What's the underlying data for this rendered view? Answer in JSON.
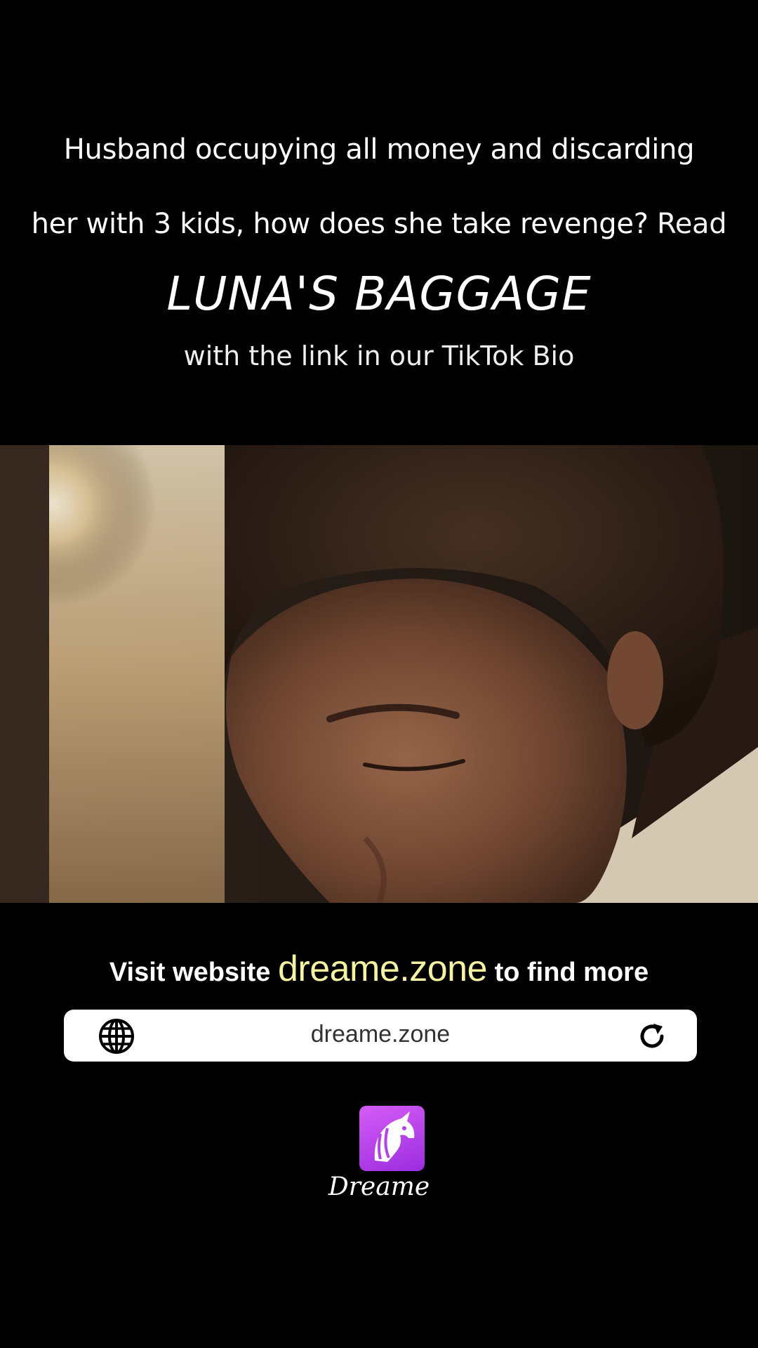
{
  "promo": {
    "line1": "Husband occupying all money and discarding",
    "line2": "her with 3 kids, how does she take revenge?",
    "read_word": "Read",
    "book_title": "LUNA'S BAGGAGE",
    "subline": "with the link in our TikTok Bio"
  },
  "cta": {
    "visit_prefix": "Visit website",
    "domain": "dreame.zone",
    "visit_suffix": "to find more"
  },
  "url_bar": {
    "url": "dreame.zone",
    "left_icon": "globe-icon",
    "right_icon": "reload-icon"
  },
  "brand": {
    "name": "Dreame",
    "logo_icon": "unicorn-logo-icon",
    "accent": "#b63ff0",
    "domain_color": "#f5f3a0"
  }
}
